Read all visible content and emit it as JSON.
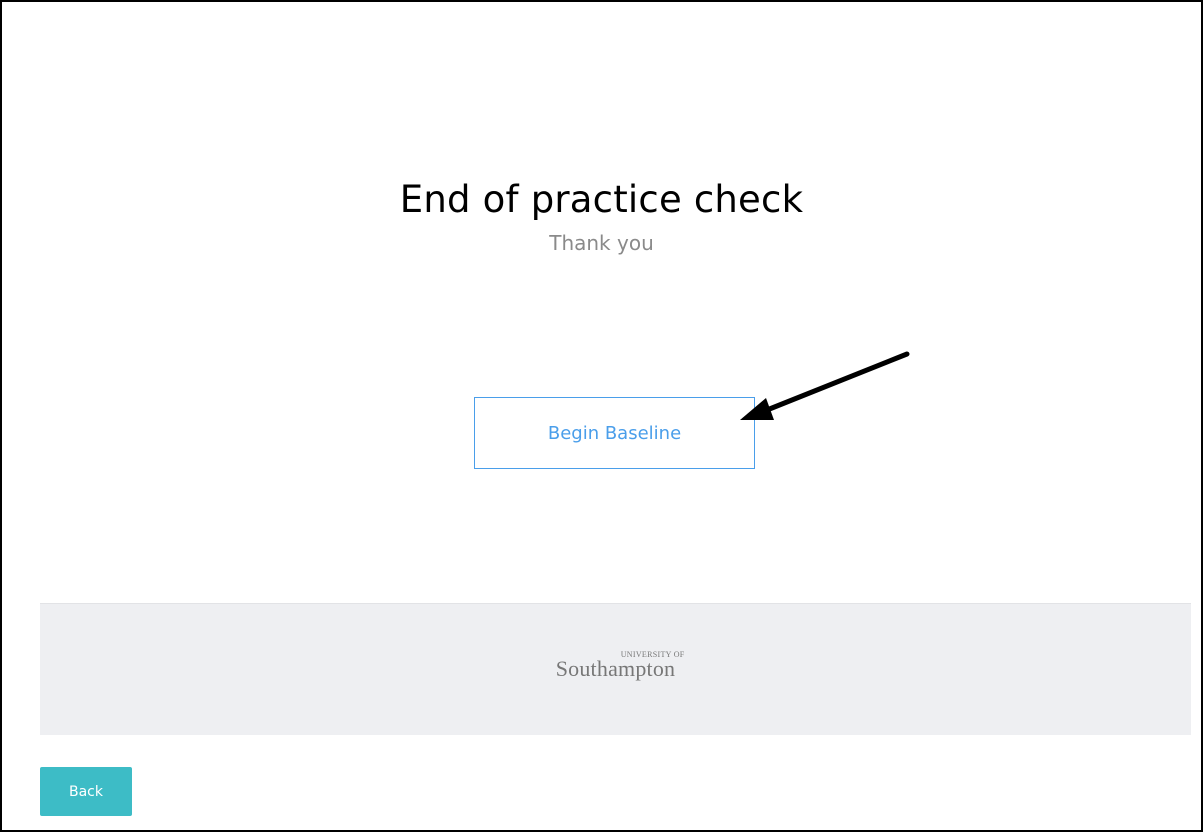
{
  "main": {
    "title": "End of practice check",
    "subtitle": "Thank you",
    "begin_button_label": "Begin Baseline"
  },
  "footer": {
    "logo_small": "UNIVERSITY OF",
    "logo_main": "Southampton"
  },
  "nav": {
    "back_label": "Back"
  },
  "colors": {
    "accent_blue": "#4a9eea",
    "back_button": "#3dbcc6",
    "footer_bg": "#eeeff2"
  }
}
